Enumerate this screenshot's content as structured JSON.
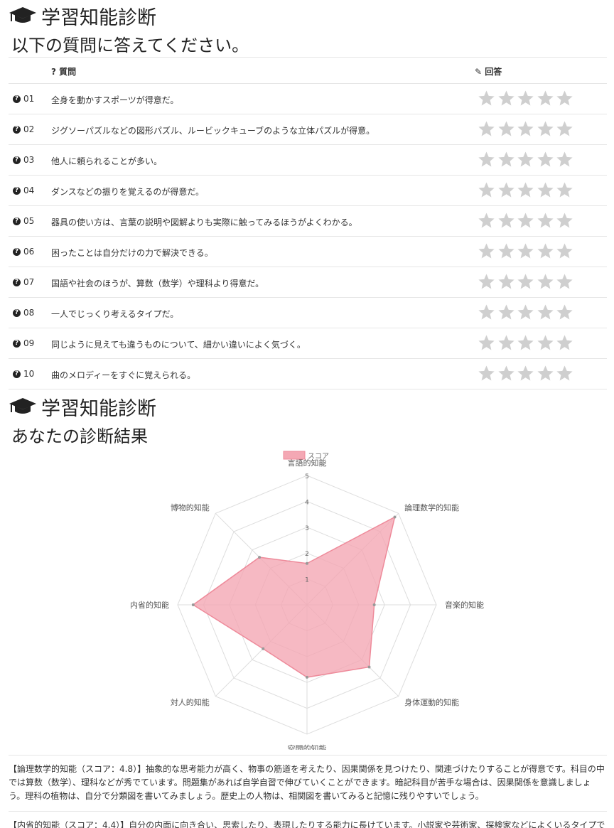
{
  "header": {
    "title": "学習知能診断",
    "subtitle": "以下の質問に答えてください。"
  },
  "table": {
    "col_question": "質問",
    "col_answer": "回答",
    "rows": [
      {
        "num": "01",
        "text": "全身を動かすスポーツが得意だ。"
      },
      {
        "num": "02",
        "text": "ジグソーパズルなどの図形パズル、ルービックキューブのような立体パズルが得意。"
      },
      {
        "num": "03",
        "text": "他人に頼られることが多い。"
      },
      {
        "num": "04",
        "text": "ダンスなどの振りを覚えるのが得意だ。"
      },
      {
        "num": "05",
        "text": "器具の使い方は、言葉の説明や図解よりも実際に触ってみるほうがよくわかる。"
      },
      {
        "num": "06",
        "text": "困ったことは自分だけの力で解決できる。"
      },
      {
        "num": "07",
        "text": "国語や社会のほうが、算数（数学）や理科より得意だ。"
      },
      {
        "num": "08",
        "text": "一人でじっくり考えるタイプだ。"
      },
      {
        "num": "09",
        "text": "同じように見えても違うものについて、細かい違いによく気づく。"
      },
      {
        "num": "10",
        "text": "曲のメロディーをすぐに覚えられる。"
      }
    ]
  },
  "result_header": {
    "title": "学習知能診断",
    "subtitle": "あなたの診断結果"
  },
  "chart_data": {
    "type": "radar",
    "legend": "スコア",
    "labels": [
      "言語的知能",
      "論理数学的知能",
      "音楽的知能",
      "身体運動的知能",
      "空間的知能",
      "対人的知能",
      "内省的知能",
      "博物的知能"
    ],
    "values": [
      1.6,
      4.8,
      2.6,
      3.4,
      2.8,
      2.4,
      4.4,
      2.6
    ],
    "rmin": 0,
    "rmax": 5,
    "ticks": [
      "1",
      "2",
      "3",
      "4",
      "5"
    ],
    "fill": "#f4a8b4",
    "stroke": "#ee8a9a"
  },
  "results": [
    {
      "text": "【論理数学的知能（スコア：4.8）】抽象的な思考能力が高く、物事の筋道を考えたり、因果関係を見つけたり、関連づけたりすることが得意です。科目の中では算数（数学）、理科などが秀でています。問題集があれば自学自習で伸びていくことができます。暗記科目が苦手な場合は、因果関係を意識しましょう。理科の植物は、自分で分類図を書いてみましょう。歴史上の人物は、相関図を書いてみると記憶に残りやすいでしょう。"
    },
    {
      "text": "【内省的知能（スコア：4.4）】自分の内面に向き合い、思索したり、表現したりする能力に長けています。小説家や芸術家、探検家などによくいるタイプで"
    }
  ]
}
